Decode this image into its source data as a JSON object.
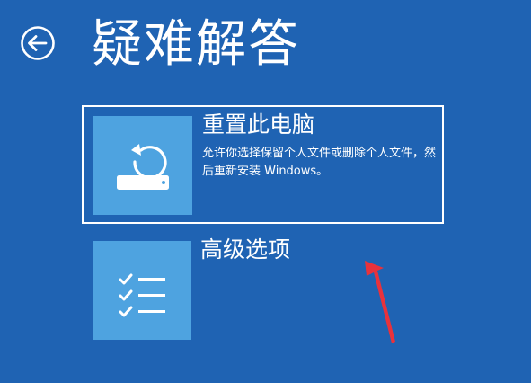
{
  "header": {
    "title": "疑难解答",
    "back_icon": "arrow-left-circle-icon"
  },
  "options": [
    {
      "title": "重置此电脑",
      "description": "允许你选择保留个人文件或删除个人文件，然后重新安装 Windows。",
      "icon": "reset-pc-icon",
      "selected": true
    },
    {
      "title": "高级选项",
      "description": "",
      "icon": "checklist-icon",
      "selected": false
    }
  ],
  "annotation": {
    "icon": "red-arrow-icon",
    "color": "#e8323c"
  },
  "colors": {
    "background": "#1f63b3",
    "tile": "#4ea3e0",
    "text": "#ffffff"
  }
}
